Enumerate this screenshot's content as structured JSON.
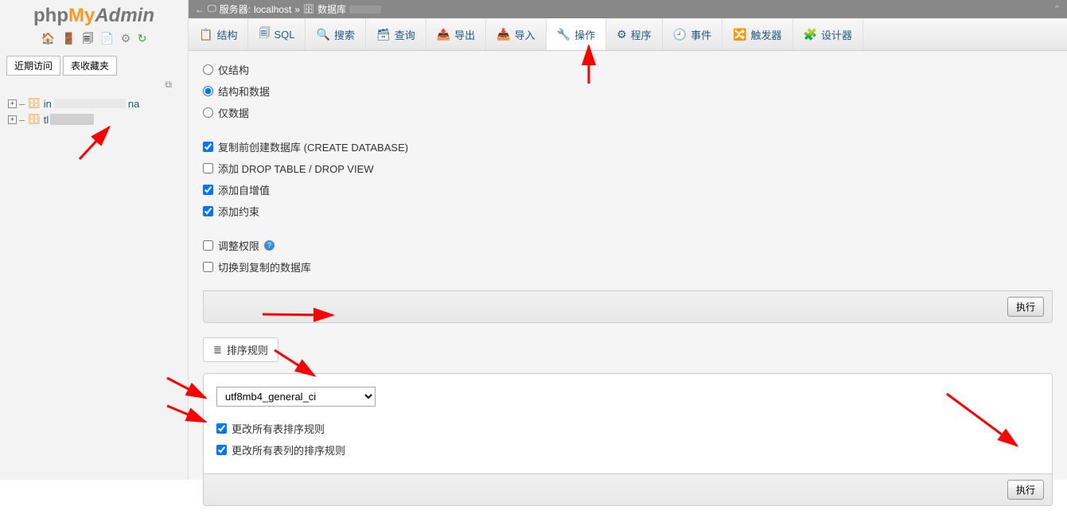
{
  "logo": {
    "php": "php",
    "my": "My",
    "admin": "Admin"
  },
  "sidebar": {
    "tabs": {
      "recent": "近期访问",
      "favorites": "表收藏夹"
    },
    "dbs": [
      {
        "name_prefix": "in",
        "selected": false
      },
      {
        "name_prefix": "tl",
        "selected": true
      }
    ],
    "db_suffix_visible": "na"
  },
  "breadcrumb": {
    "server_label": "服务器:",
    "server_value": "localhost",
    "sep": "»",
    "db_label": "数据库"
  },
  "toolbar": [
    {
      "icon": "📋",
      "label": "结构"
    },
    {
      "icon": "🗐",
      "label": "SQL"
    },
    {
      "icon": "🔍",
      "label": "搜索"
    },
    {
      "icon": "🗃",
      "label": "查询"
    },
    {
      "icon": "📤",
      "label": "导出"
    },
    {
      "icon": "📥",
      "label": "导入"
    },
    {
      "icon": "🔧",
      "label": "操作",
      "active": true
    },
    {
      "icon": "⚙",
      "label": "程序"
    },
    {
      "icon": "🕘",
      "label": "事件"
    },
    {
      "icon": "🔀",
      "label": "触发器"
    },
    {
      "icon": "🧩",
      "label": "设计器"
    }
  ],
  "radios": {
    "structure_only": "仅结构",
    "structure_and_data": "结构和数据",
    "data_only": "仅数据",
    "selected": "structure_and_data"
  },
  "checks1": {
    "create_db": {
      "label": "复制前创建数据库 (CREATE DATABASE)",
      "checked": true
    },
    "drop": {
      "label": "添加 DROP TABLE / DROP VIEW",
      "checked": false
    },
    "auto_inc": {
      "label": "添加自增值",
      "checked": true
    },
    "constraints": {
      "label": "添加约束",
      "checked": true
    }
  },
  "checks2": {
    "adjust_priv": {
      "label": "调整权限",
      "checked": false
    },
    "switch_db": {
      "label": "切换到复制的数据库",
      "checked": false
    }
  },
  "buttons": {
    "execute": "执行"
  },
  "panel2": {
    "legend": "排序规则",
    "select_value": "utf8mb4_general_ci",
    "change_tables": {
      "label": "更改所有表排序规则",
      "checked": true
    },
    "change_columns": {
      "label": "更改所有表列的排序规则",
      "checked": true
    }
  }
}
